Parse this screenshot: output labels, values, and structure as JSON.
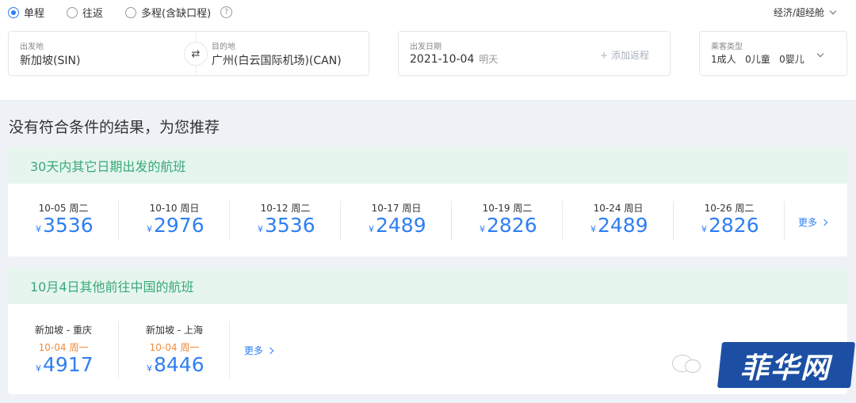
{
  "trip_type": {
    "options": [
      {
        "label": "单程",
        "checked": true
      },
      {
        "label": "往返",
        "checked": false
      },
      {
        "label": "多程(含缺口程)",
        "checked": false
      }
    ],
    "help_icon": "?"
  },
  "cabin_select": {
    "value": "经济/超经舱",
    "icon": "chevron-down-icon"
  },
  "route": {
    "from_label": "出发地",
    "from_value": "新加坡(SIN)",
    "to_label": "目的地",
    "to_value": "广州(白云国际机场)(CAN)",
    "swap_icon": "⇄"
  },
  "date": {
    "label": "出发日期",
    "value": "2021-10-04",
    "weekday": "明天",
    "add_return": "+ 添加返程"
  },
  "passengers": {
    "label": "乘客类型",
    "value": "1成人   0儿童   0婴儿"
  },
  "headline": "没有符合条件的结果，为您推荐",
  "other_dates": {
    "title": "30天内其它日期出发的航班",
    "currency": "¥",
    "items": [
      {
        "date": "10-05 周二",
        "price": "3536"
      },
      {
        "date": "10-10 周日",
        "price": "2976"
      },
      {
        "date": "10-12 周二",
        "price": "3536"
      },
      {
        "date": "10-17 周日",
        "price": "2489"
      },
      {
        "date": "10-19 周二",
        "price": "2826"
      },
      {
        "date": "10-24 周日",
        "price": "2489"
      },
      {
        "date": "10-26 周二",
        "price": "2826"
      }
    ],
    "more": "更多"
  },
  "other_routes": {
    "title": "10月4日其他前往中国的航班",
    "currency": "¥",
    "items": [
      {
        "route": "新加坡 - 重庆",
        "date": "10-04 周一",
        "price": "4917"
      },
      {
        "route": "新加坡 - 上海",
        "date": "10-04 周一",
        "price": "8446"
      }
    ],
    "more": "更多"
  },
  "watermark": {
    "text": "菲华网"
  },
  "colors": {
    "accent": "#2f7ff3",
    "green_header": "#e6f6ef",
    "green_text": "#3aa877",
    "orange": "#f08a3a"
  }
}
